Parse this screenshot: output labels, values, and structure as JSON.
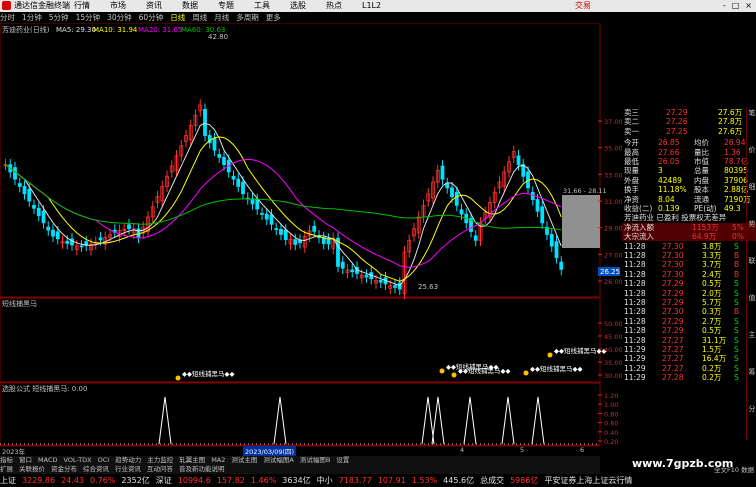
{
  "window": {
    "app_title": "通达信金融终端",
    "menu": [
      "行情",
      "市场",
      "资讯",
      "数据",
      "专题",
      "工具",
      "选股",
      "热点",
      "L1L2"
    ],
    "trade_label": "交易",
    "win_controls": [
      "-",
      "□",
      "×"
    ]
  },
  "period_bar": {
    "items": [
      "分时",
      "1分钟",
      "5分钟",
      "15分钟",
      "30分钟",
      "60分钟",
      "日线",
      "周线",
      "月线",
      "多周期",
      "更多"
    ],
    "active_index": 6
  },
  "main_chart": {
    "legend": {
      "stock": "芳迪药业(日线)",
      "ma5": "MA5: 29.30",
      "ma10": "MA10: 31.94",
      "ma20": "MA20: 31.65",
      "ma60": "MA60: 30.63"
    },
    "high_label": "42.80",
    "low_label": "25.63",
    "range_label": "31.66 - 28.11",
    "price_badge": "26.25",
    "y_ticks": [
      "37.00",
      "35.00",
      "33.00",
      "31.00",
      "29.00",
      "27.00",
      "26.00"
    ]
  },
  "indicator1": {
    "name": "短线捕黑马",
    "y_ticks": [
      "50.00",
      "45.00",
      "40.00",
      "35.00",
      "30.00"
    ],
    "signal_label": "短线捕黑马",
    "signals": [
      {
        "x": 0.3,
        "label": "◆◆短线捕黑马◆◆"
      },
      {
        "x": 0.74,
        "label": "◆◆短线捕黑马◆◆"
      },
      {
        "x": 0.76,
        "label": "◆◆短线捕黑马◆◆"
      },
      {
        "x": 0.88,
        "label": "◆◆短线捕黑马◆◆"
      },
      {
        "x": 0.92,
        "label": "◆◆短线捕黑马◆◆"
      }
    ]
  },
  "indicator2": {
    "name": "选股公式 短线捕黑马: 0.00",
    "y_ticks": [
      "1.20",
      "1.00",
      "0.80",
      "0.60",
      "0.40",
      "0.20"
    ]
  },
  "x_axis": {
    "left_label": "2023年",
    "date_label": "2023/03/09(四)",
    "ticks": [
      "4",
      "5",
      "6"
    ]
  },
  "quote_panel": {
    "asks": [
      {
        "label": "卖三",
        "price": "27.29",
        "vol": "27.6万"
      },
      {
        "label": "卖二",
        "price": "27.26",
        "vol": "27.8万"
      },
      {
        "label": "卖一",
        "price": "27.25",
        "vol": "27.6万"
      }
    ],
    "stats": [
      {
        "l1": "今开",
        "v1": "26.85",
        "l2": "均价",
        "v2": "26.94"
      },
      {
        "l1": "最高",
        "v1": "27.66",
        "l2": "量比",
        "v2": "1.36"
      },
      {
        "l1": "最低",
        "v1": "26.05",
        "l2": "市值",
        "v2": "78.7亿"
      },
      {
        "l1": "现量",
        "v1": "3",
        "l2": "总量",
        "v2": "80395"
      },
      {
        "l1": "外盘",
        "v1": "42489",
        "l2": "内盘",
        "v2": "37906"
      },
      {
        "l1": "换手",
        "v1": "11.18%",
        "l2": "股本",
        "v2": "2.88亿"
      },
      {
        "l1": "净资",
        "v1": "8.04",
        "l2": "流通",
        "v2": "7190万"
      },
      {
        "l1": "收益(二)",
        "v1": "0.139",
        "l2": "PE(动)",
        "v2": "49.3"
      }
    ],
    "company_line": "芳迪药业 已盈利 投票权无差异",
    "netflow": {
      "label": "净流入额",
      "value": "1153万",
      "pct": "5%"
    },
    "bigflow": {
      "label": "大宗流入",
      "value": "64.9万",
      "pct": "0%"
    },
    "ticks": [
      {
        "t": "11:28",
        "p": "27.30",
        "v": "3.8万",
        "d": "S"
      },
      {
        "t": "11:28",
        "p": "27.30",
        "v": "3.3万",
        "d": "B"
      },
      {
        "t": "11:28",
        "p": "27.30",
        "v": "3.7万",
        "d": "B"
      },
      {
        "t": "11:28",
        "p": "27.30",
        "v": "2.4万",
        "d": "B"
      },
      {
        "t": "11:28",
        "p": "27.29",
        "v": "0.5万",
        "d": "S"
      },
      {
        "t": "11:28",
        "p": "27.29",
        "v": "2.0万",
        "d": "S"
      },
      {
        "t": "11:28",
        "p": "27.29",
        "v": "5.7万",
        "d": "S"
      },
      {
        "t": "11:28",
        "p": "27.30",
        "v": "0.3万",
        "d": "B"
      },
      {
        "t": "11:28",
        "p": "27.29",
        "v": "2.7万",
        "d": "S"
      },
      {
        "t": "11:28",
        "p": "27.29",
        "v": "0.5万",
        "d": "S"
      },
      {
        "t": "11:28",
        "p": "27.27",
        "v": "31.1万",
        "d": "S"
      },
      {
        "t": "11:29",
        "p": "27.27",
        "v": "1.5万",
        "d": "S"
      },
      {
        "t": "11:29",
        "p": "27.27",
        "v": "16.4万",
        "d": "S"
      },
      {
        "t": "11:29",
        "p": "27.27",
        "v": "0.2万",
        "d": "S"
      },
      {
        "t": "11:29",
        "p": "27.28",
        "v": "0.2万",
        "d": "S"
      }
    ],
    "tab_labels": [
      "笔",
      "价",
      "细",
      "势",
      "联",
      "值",
      "主",
      "筹",
      "分"
    ]
  },
  "bottom_tabs1": [
    "指标",
    "窗口",
    "MACD",
    "VOL-TDX",
    "OCI",
    "趋势动力",
    "主力监控",
    "轧翼主图",
    "MA2",
    "测试主图",
    "测试幅图A",
    "测试幅图B",
    "设置"
  ],
  "bottom_tabs2": [
    "扩展",
    "关联报价",
    "资金分布",
    "综合资讯",
    "行业资讯",
    "互动问答",
    "普及新功能说明"
  ],
  "right_bottom": {
    "label1": "缓板",
    "label2": "全文F10 数据"
  },
  "status": [
    {
      "name": "上证",
      "value": "3229.86",
      "chg": "24.43",
      "pct": "0.76%",
      "amt": "2352亿"
    },
    {
      "name": "深证",
      "value": "10994.6",
      "chg": "157.82",
      "pct": "1.46%",
      "amt": "3634亿"
    },
    {
      "name": "中小",
      "value": "7183.77",
      "chg": "107.91",
      "pct": "1.53%",
      "amt": "445.6亿"
    },
    {
      "name": "总成交",
      "value": "5986亿",
      "chg": "",
      "pct": "",
      "amt": ""
    }
  ],
  "status_tail": "平安证券上海上证云行情",
  "watermark": "www.7gpzb.com",
  "colors": {
    "up": "#ff3030",
    "down": "#00e0ff",
    "ma5": "#e0e0e0",
    "ma10": "#ffff00",
    "ma20": "#ff00ff",
    "ma60": "#00c000",
    "bg": "#000000"
  }
}
